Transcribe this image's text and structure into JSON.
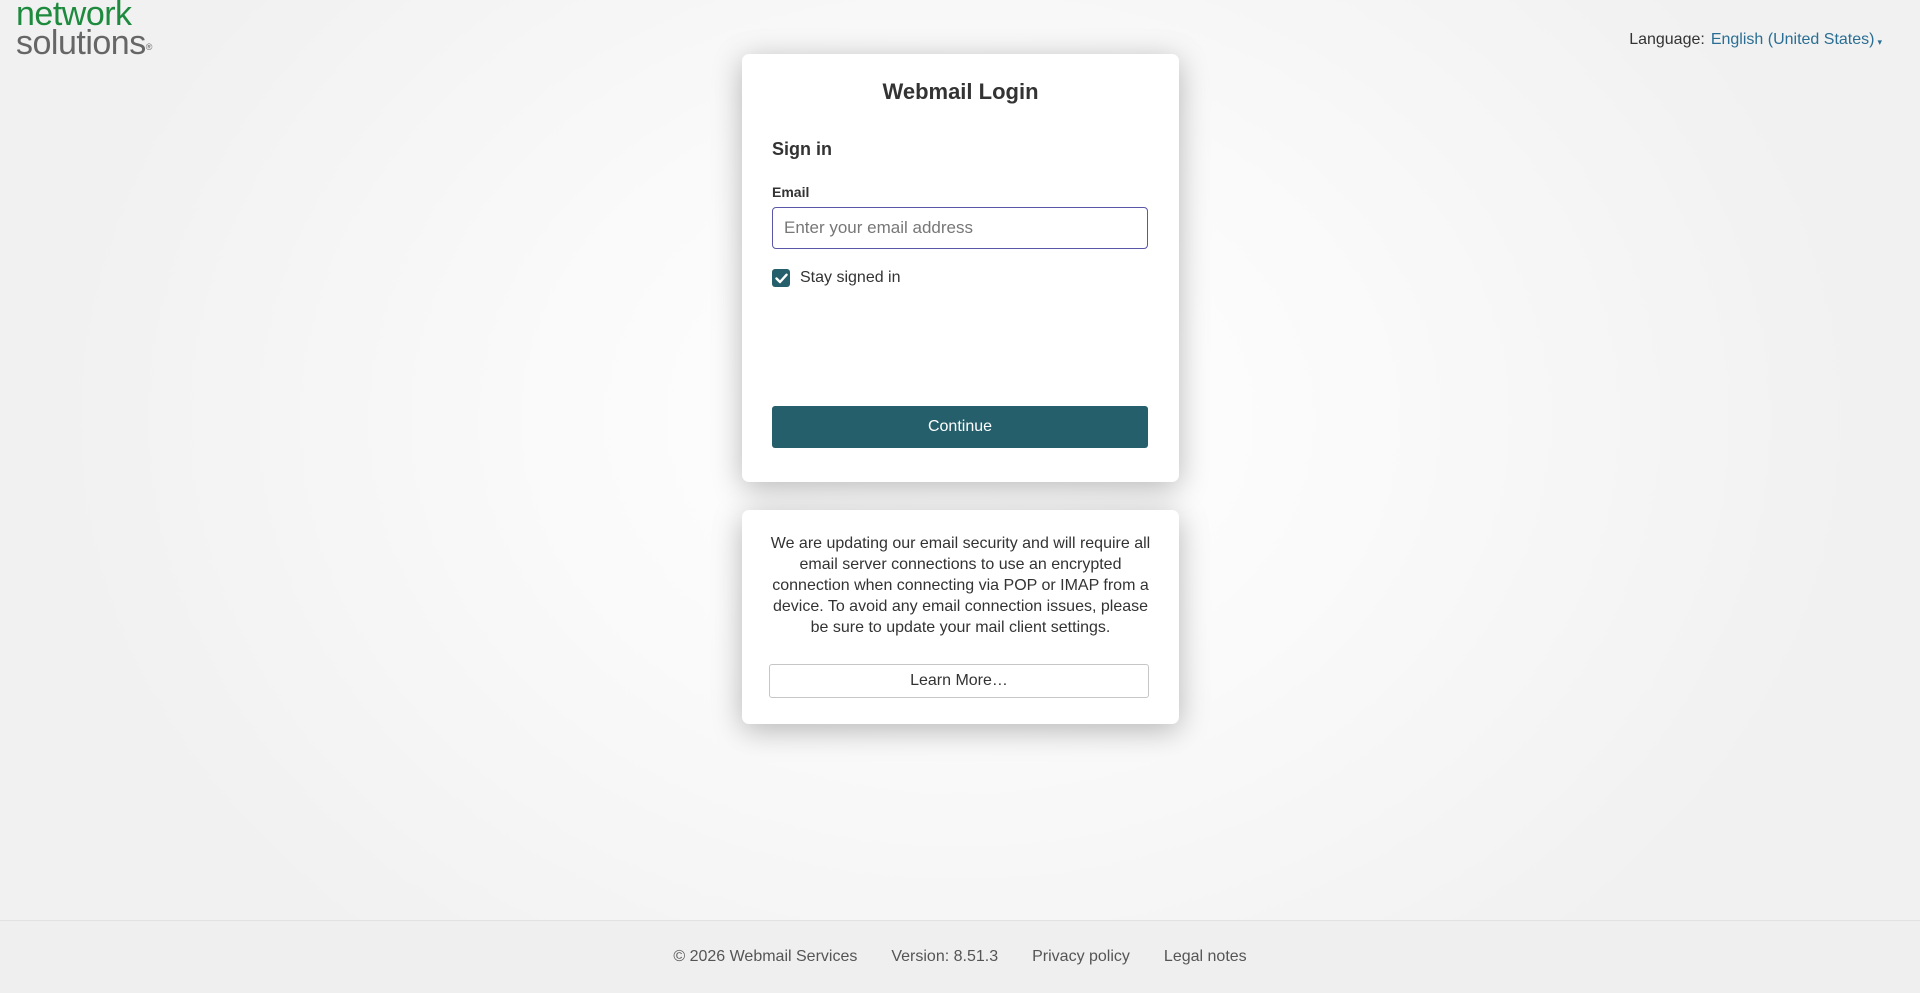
{
  "logo": {
    "line1": "network",
    "line2": "solutions",
    "registered": "®"
  },
  "language": {
    "label": "Language:",
    "value": "English (United States)",
    "caret": "▾"
  },
  "login": {
    "title": "Webmail Login",
    "subtitle": "Sign in",
    "email_label": "Email",
    "email_value": "",
    "email_placeholder": "Enter your email address",
    "stay_signed_in_label": "Stay signed in",
    "stay_signed_in_checked": true,
    "continue_label": "Continue"
  },
  "notice": {
    "text": "We are updating our email security and will require all email server connections to use an encrypted connection when connecting via POP or IMAP from a device. To avoid any email connection issues, please be sure to update your mail client settings.",
    "learn_more_label": "Learn More…"
  },
  "footer": {
    "copyright": "© 2026 Webmail Services",
    "version": "Version: 8.51.3",
    "privacy": "Privacy policy",
    "legal": "Legal notes"
  },
  "colors": {
    "brand_green": "#1e8a3e",
    "primary_teal": "#245f6b",
    "link_blue": "#2a6e93",
    "input_focus_border": "#5b57a8"
  }
}
